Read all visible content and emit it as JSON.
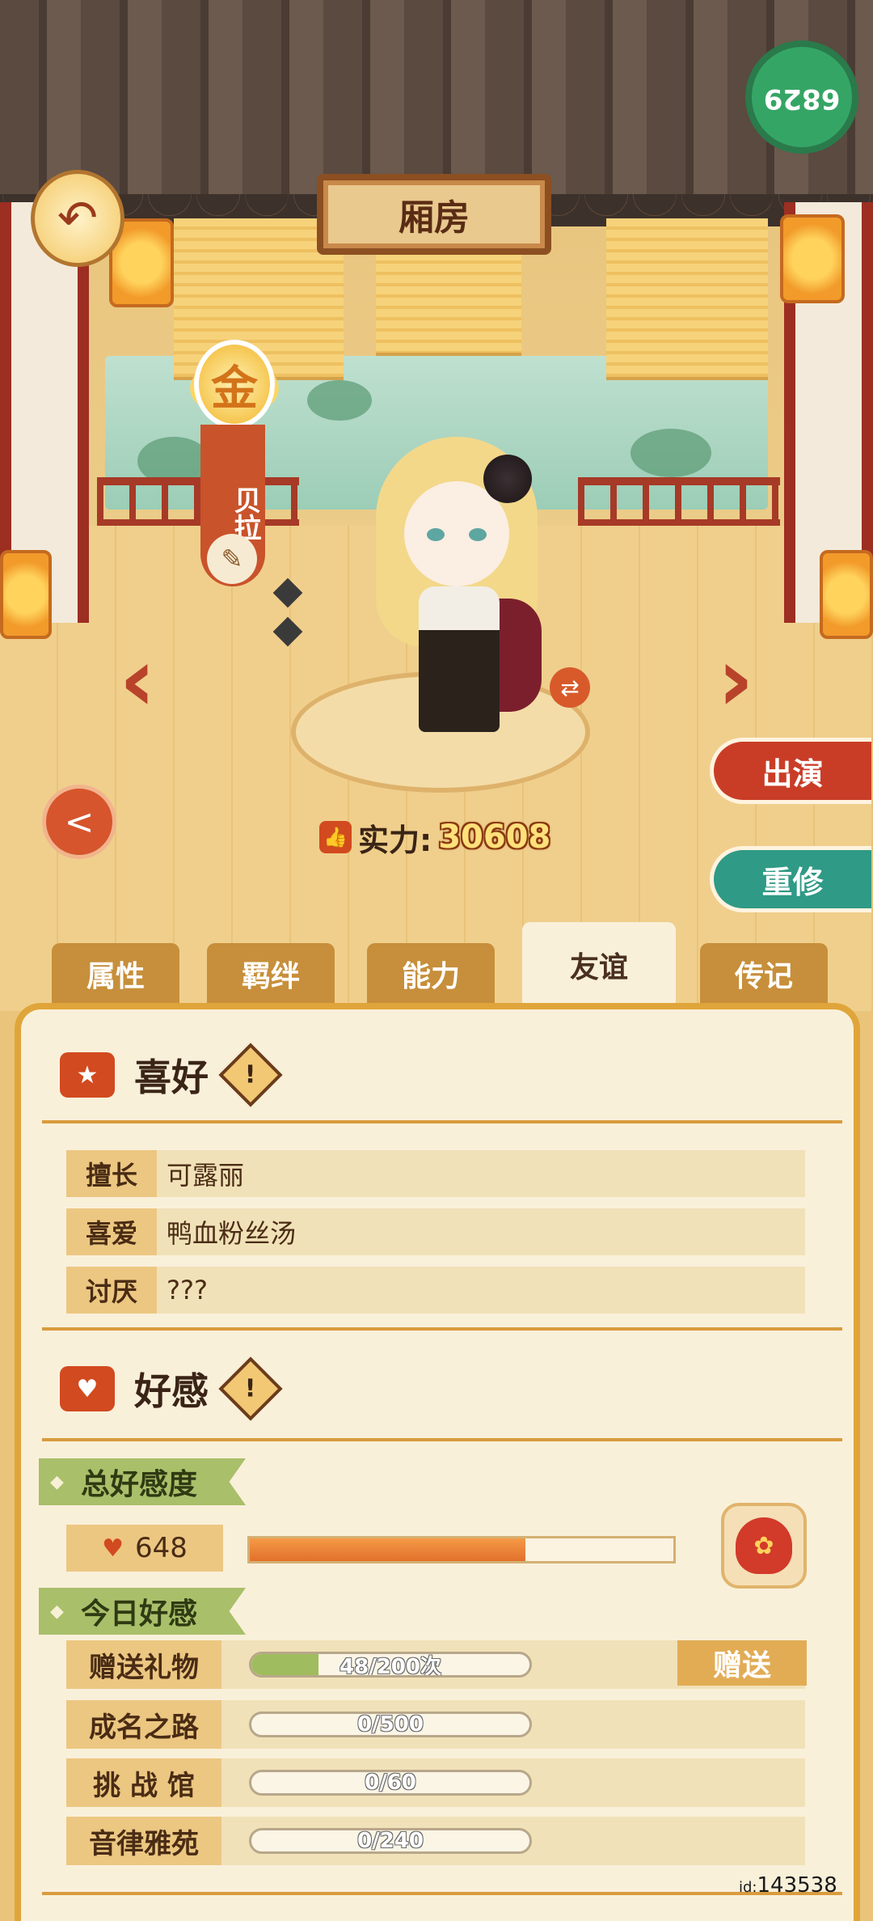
{
  "header": {
    "title": "厢房",
    "corner_value": "6829"
  },
  "character": {
    "rank": "金",
    "name": "贝拉",
    "power_label": "实力:",
    "power_value": "30608"
  },
  "actions": {
    "perform": "出演",
    "retrain": "重修"
  },
  "tabs": [
    {
      "label": "属性",
      "active": false
    },
    {
      "label": "羁绊",
      "active": false
    },
    {
      "label": "能力",
      "active": false
    },
    {
      "label": "友谊",
      "active": true
    },
    {
      "label": "传记",
      "active": false
    }
  ],
  "preferences": {
    "title": "喜好",
    "rows": [
      {
        "key": "擅长",
        "value": "可露丽"
      },
      {
        "key": "喜爱",
        "value": "鸭血粉丝汤"
      },
      {
        "key": "讨厌",
        "value": "???"
      }
    ]
  },
  "affection": {
    "title": "好感",
    "total_label": "总好感度",
    "total_value": "648",
    "total_fill": 0.65,
    "today_label": "今日好感",
    "rows": [
      {
        "key": "赠送礼物",
        "progress": "48/200次",
        "fill": 0.24
      },
      {
        "key": "成名之路",
        "progress": "0/500",
        "fill": 0
      },
      {
        "key": "挑 战 馆",
        "progress": "0/60",
        "fill": 0
      },
      {
        "key": "音律雅苑",
        "progress": "0/240",
        "fill": 0
      }
    ],
    "gift_button": "赠送"
  },
  "footer": {
    "id_prefix": "id:",
    "id_value": "143538"
  },
  "icons": {
    "back": "back-arrow-icon",
    "share": "share-icon",
    "brush": "brush-icon",
    "swap": "swap-icon",
    "prev": "chevron-left-icon",
    "next": "chevron-right-icon",
    "thumb": "thumbs-up-icon",
    "warn": "exclamation-icon",
    "heart": "heart-icon",
    "bag": "gift-bag-icon"
  },
  "colors": {
    "accent": "#d24a1f",
    "teal": "#2f9a85",
    "panel": "#f9f0da",
    "ribbon": "#a9bf6a"
  }
}
